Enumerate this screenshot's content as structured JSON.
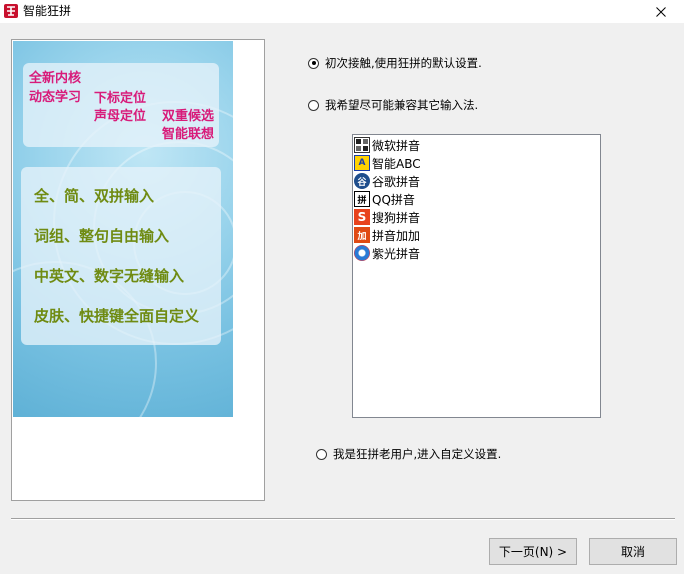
{
  "window": {
    "title": "智能狂拼"
  },
  "banner": {
    "pink_lines": [
      "全新内核",
      "动态学习",
      "下标定位",
      "声母定位",
      "双重候选",
      "智能联想"
    ],
    "green_lines": [
      "全、简、双拼输入",
      "词组、整句自由输入",
      "中英文、数字无缝输入",
      "皮肤、快捷键全面自定义"
    ]
  },
  "options": {
    "first_use": {
      "label": "初次接触,使用狂拼的默认设置.",
      "selected": true
    },
    "compatible": {
      "label": "我希望尽可能兼容其它输入法.",
      "selected": false
    },
    "old_user": {
      "label": "我是狂拼老用户,进入自定义设置.",
      "selected": false
    }
  },
  "ime_list": [
    {
      "label": "微软拼音",
      "icon": "microsoft-pinyin-icon"
    },
    {
      "label": "智能ABC",
      "icon": "abc-icon"
    },
    {
      "label": "谷歌拼音",
      "icon": "google-pinyin-icon"
    },
    {
      "label": "QQ拼音",
      "icon": "qq-pinyin-icon"
    },
    {
      "label": "搜狗拼音",
      "icon": "sogou-icon"
    },
    {
      "label": "拼音加加",
      "icon": "pinyin-jiajia-icon"
    },
    {
      "label": "紫光拼音",
      "icon": "ziguang-icon"
    }
  ],
  "buttons": {
    "next": "下一页(N) >",
    "cancel": "取消"
  },
  "colors": {
    "accent_pink": "#d81b7a",
    "accent_green": "#6f8b12",
    "banner_blue": "#79c2e2"
  }
}
